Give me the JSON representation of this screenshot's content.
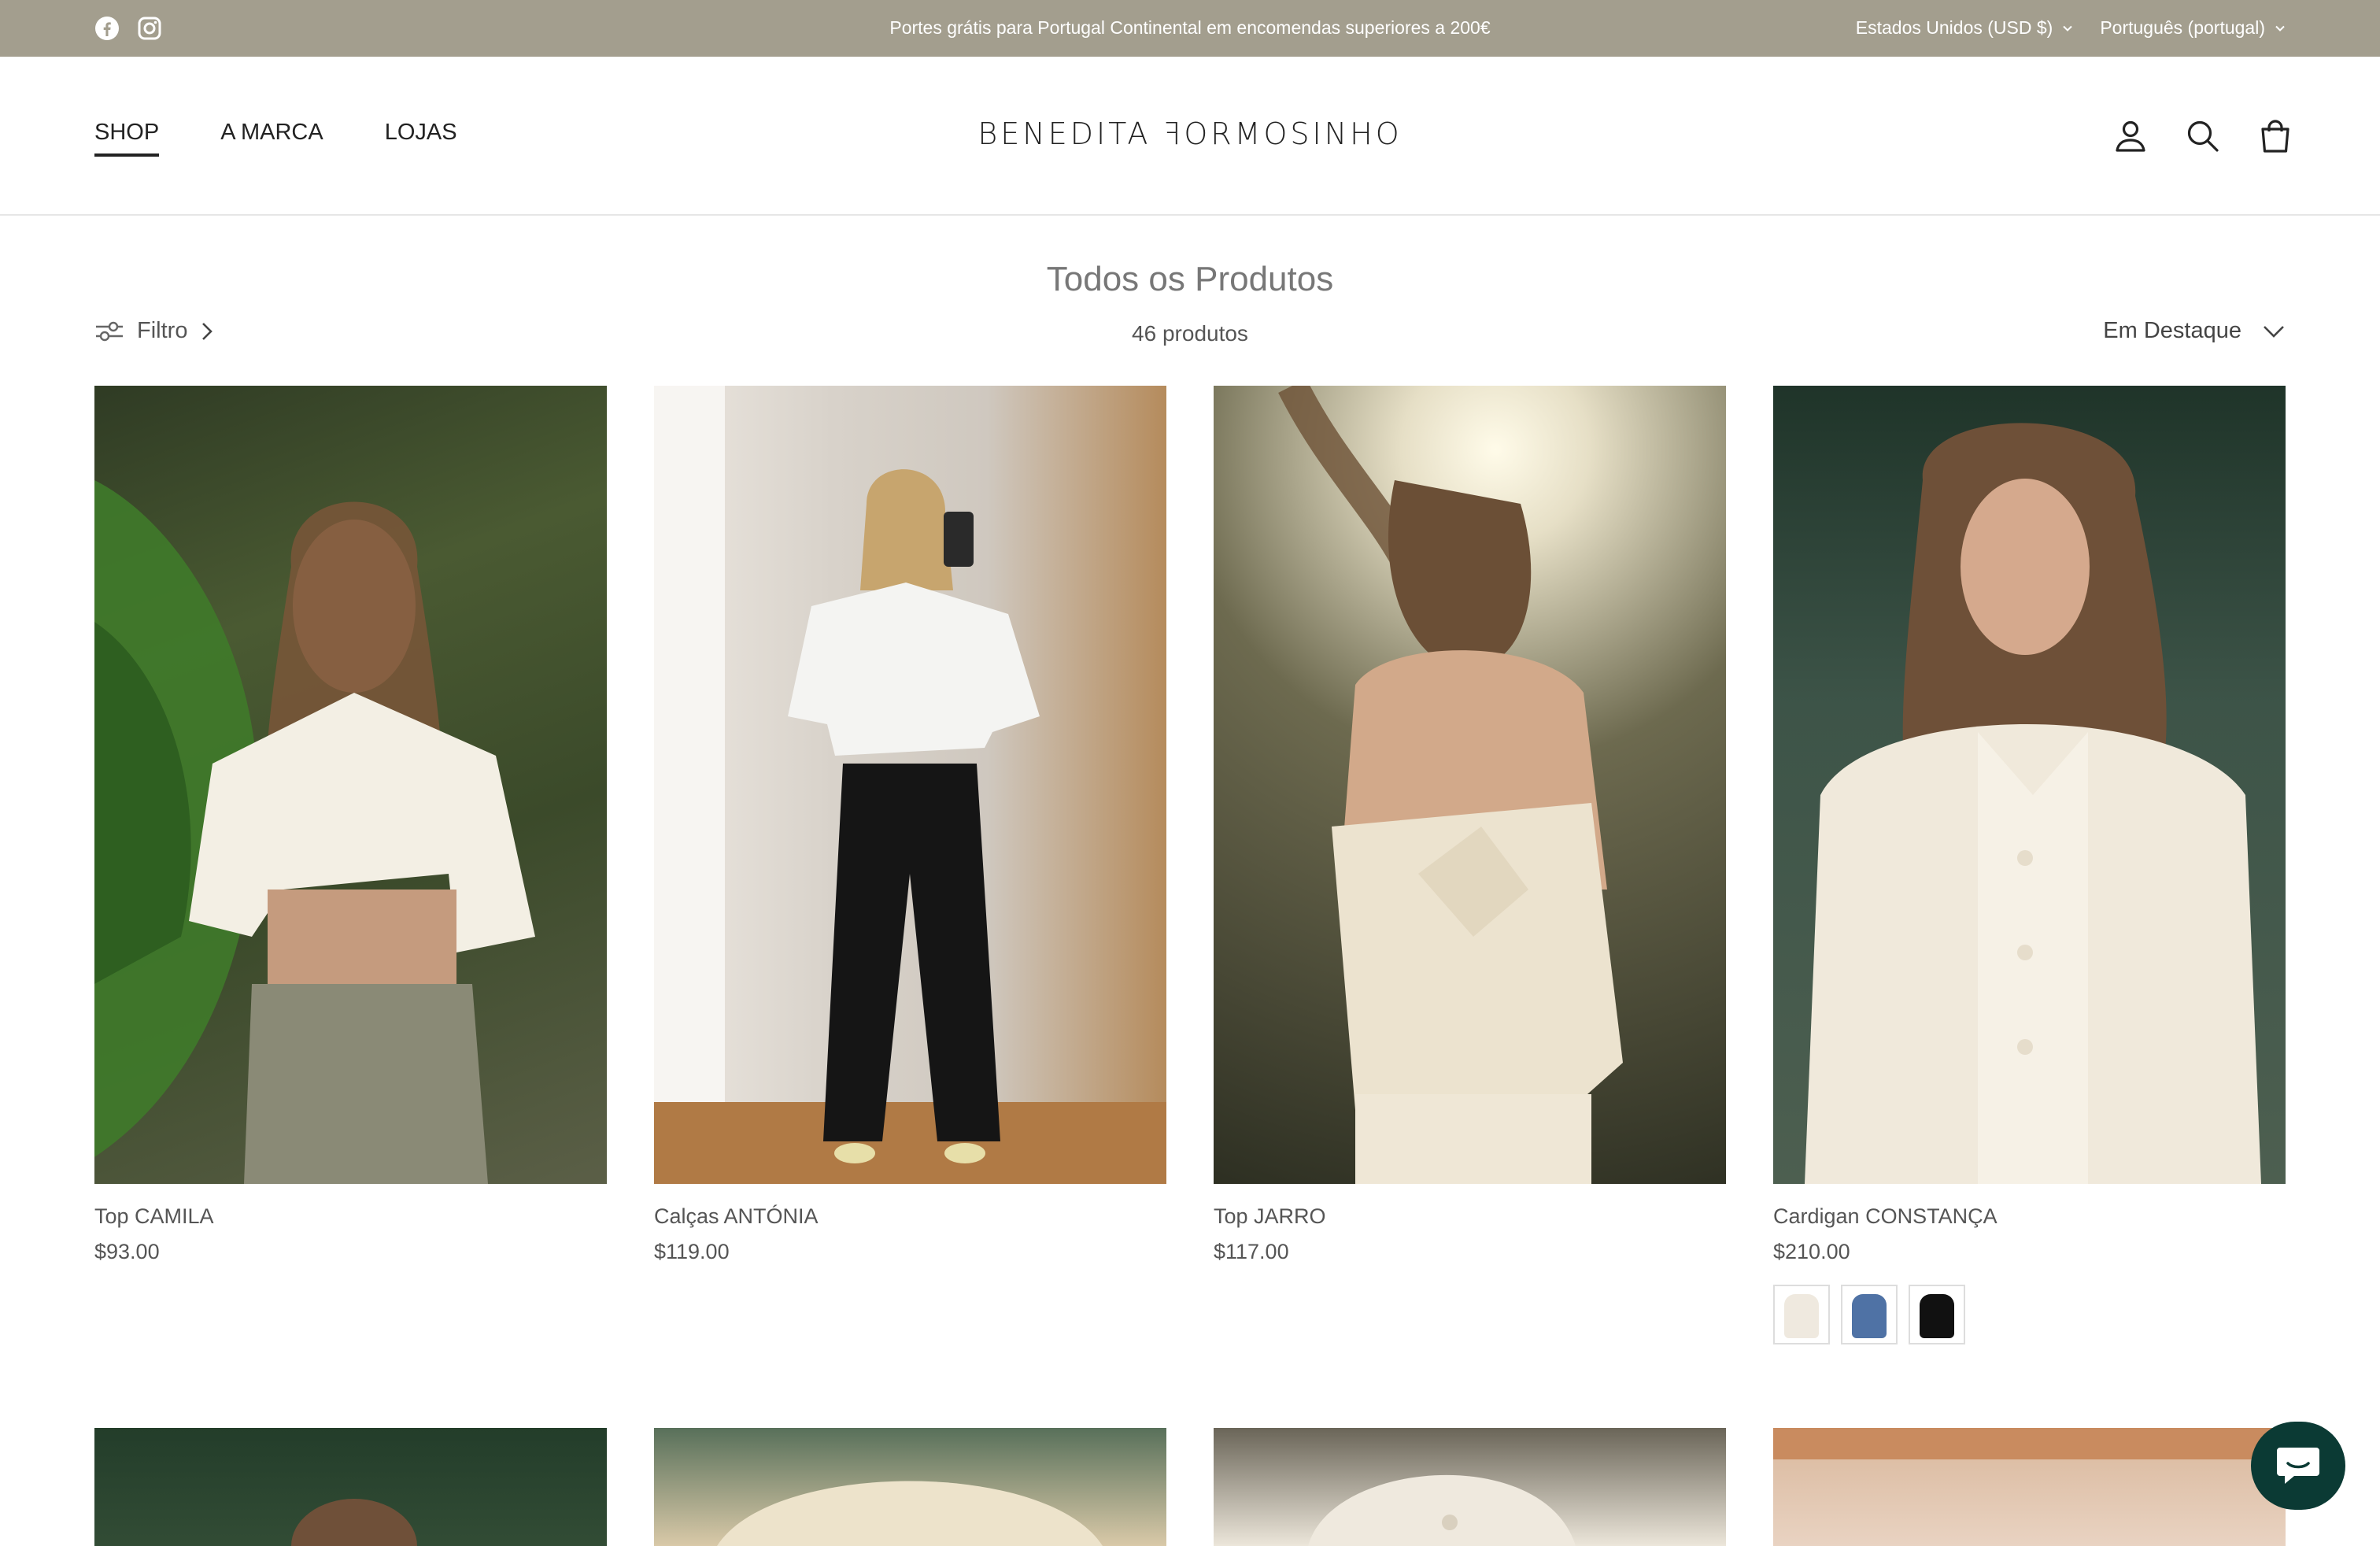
{
  "announcement": {
    "text": "Portes grátis para Portugal Continental em encomendas superiores a 200€",
    "social": [
      "facebook-icon",
      "instagram-icon"
    ],
    "country": "Estados Unidos (USD $)",
    "language": "Português (portugal)"
  },
  "header": {
    "nav": [
      "SHOP",
      "A MARCA",
      "LOJAS"
    ],
    "logo": "BENEDITA ꟻORMOSINHO",
    "icons": [
      "account-icon",
      "search-icon",
      "cart-icon"
    ]
  },
  "collection": {
    "title": "Todos os Produtos",
    "count": "46 produtos",
    "filter_label": "Filtro",
    "sort_label": "Em Destaque"
  },
  "products": [
    {
      "name": "Top CAMILA",
      "price": "$93.00"
    },
    {
      "name": "Calças ANTÓNIA",
      "price": "$119.00"
    },
    {
      "name": "Top JARRO",
      "price": "$117.00"
    },
    {
      "name": "Cardigan CONSTANÇA",
      "price": "$210.00",
      "swatches": [
        "#efe9df",
        "#4f72a5",
        "#111111"
      ]
    }
  ],
  "colors": {
    "announcement_bg": "#a39e8e",
    "chat_bg": "#0b3a34"
  }
}
